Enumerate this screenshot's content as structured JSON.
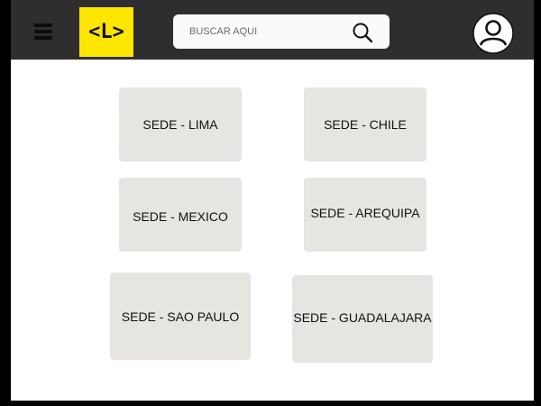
{
  "header": {
    "logo_text": "<L>",
    "search": {
      "placeholder": "BUSCAR AQUI"
    }
  },
  "icons": {
    "menu": "hamburger-icon",
    "search": "search-icon",
    "avatar": "user-avatar-icon"
  },
  "colors": {
    "topbar": "#2e2e2e",
    "logo_bg": "#ffe600",
    "card_bg": "#e6e5e1",
    "content_bg": "#ffffff"
  },
  "sedes": [
    {
      "label": "SEDE - LIMA"
    },
    {
      "label": "SEDE - CHILE"
    },
    {
      "label": "SEDE - MEXICO"
    },
    {
      "label": "SEDE - AREQUIPA"
    },
    {
      "label": "SEDE - SAO PAULO"
    },
    {
      "label": "SEDE - GUADALAJARA"
    }
  ]
}
